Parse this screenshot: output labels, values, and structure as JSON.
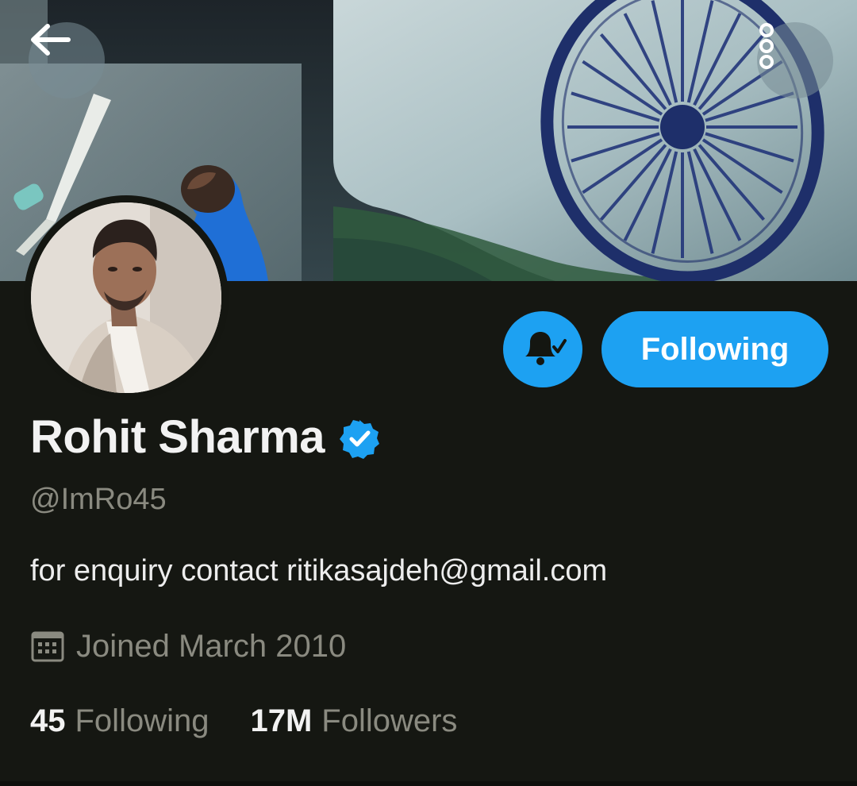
{
  "header": {
    "back_icon": "arrow-left-icon",
    "more_icon": "more-vertical-icon"
  },
  "profile": {
    "display_name": "Rohit Sharma",
    "verified_icon": "verified-badge-icon",
    "handle": "@ImRo45",
    "bio": "for enquiry contact ritikasajdeh@gmail.com",
    "joined_icon": "calendar-icon",
    "joined": "Joined March 2010"
  },
  "actions": {
    "notifications_icon": "bell-check-icon",
    "follow_label": "Following"
  },
  "stats": [
    {
      "count": "45",
      "label": "Following"
    },
    {
      "count": "17M",
      "label": "Followers"
    }
  ],
  "colors": {
    "accent": "#1da1f2",
    "background": "#151712",
    "text_primary": "#f2f2f2",
    "text_secondary": "#8a8a80"
  }
}
